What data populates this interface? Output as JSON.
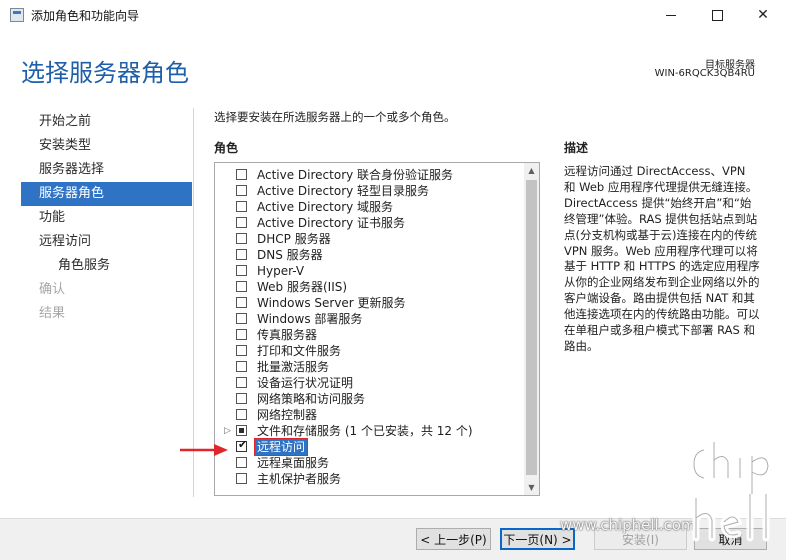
{
  "window": {
    "title": "添加角色和功能向导",
    "controls": {
      "minimize": "minimize-icon",
      "maximize": "maximize-icon",
      "close": "✕"
    }
  },
  "header": {
    "page_title": "选择服务器角色",
    "target_label": "目标服务器",
    "target_name": "WIN-6RQCK3QB4RU"
  },
  "nav": {
    "items": [
      {
        "label": "开始之前",
        "state": "normal"
      },
      {
        "label": "安装类型",
        "state": "normal"
      },
      {
        "label": "服务器选择",
        "state": "normal"
      },
      {
        "label": "服务器角色",
        "state": "active"
      },
      {
        "label": "功能",
        "state": "normal"
      },
      {
        "label": "远程访问",
        "state": "normal"
      },
      {
        "label": "角色服务",
        "state": "sub"
      },
      {
        "label": "确认",
        "state": "disabled"
      },
      {
        "label": "结果",
        "state": "disabled"
      }
    ]
  },
  "main": {
    "instruction": "选择要安装在所选服务器上的一个或多个角色。",
    "roles_header": "角色",
    "description_header": "描述",
    "description": "远程访问通过 DirectAccess、VPN 和 Web 应用程序代理提供无缝连接。DirectAccess 提供“始终开启”和“始终管理”体验。RAS 提供包括站点到站点(分支机构或基于云)连接在内的传统 VPN 服务。Web 应用程序代理可以将基于 HTTP 和 HTTPS 的选定应用程序从你的企业网络发布到企业网络以外的客户端设备。路由提供包括 NAT 和其他连接选项在内的传统路由功能。可以在单租户或多租户模式下部署 RAS 和路由。"
  },
  "roles": [
    {
      "label": "Active Directory 联合身份验证服务",
      "state": "unchecked"
    },
    {
      "label": "Active Directory 轻型目录服务",
      "state": "unchecked"
    },
    {
      "label": "Active Directory 域服务",
      "state": "unchecked"
    },
    {
      "label": "Active Directory 证书服务",
      "state": "unchecked"
    },
    {
      "label": "DHCP 服务器",
      "state": "unchecked"
    },
    {
      "label": "DNS 服务器",
      "state": "unchecked"
    },
    {
      "label": "Hyper-V",
      "state": "unchecked"
    },
    {
      "label": "Web 服务器(IIS)",
      "state": "unchecked"
    },
    {
      "label": "Windows Server 更新服务",
      "state": "unchecked"
    },
    {
      "label": "Windows 部署服务",
      "state": "unchecked"
    },
    {
      "label": "传真服务器",
      "state": "unchecked"
    },
    {
      "label": "打印和文件服务",
      "state": "unchecked"
    },
    {
      "label": "批量激活服务",
      "state": "unchecked"
    },
    {
      "label": "设备运行状况证明",
      "state": "unchecked"
    },
    {
      "label": "网络策略和访问服务",
      "state": "unchecked"
    },
    {
      "label": "网络控制器",
      "state": "unchecked"
    },
    {
      "label": "文件和存储服务 (1 个已安装，共 12 个)",
      "state": "partial",
      "expandable": true
    },
    {
      "label": "远程访问",
      "state": "checked",
      "selected": true
    },
    {
      "label": "远程桌面服务",
      "state": "unchecked"
    },
    {
      "label": "主机保护者服务",
      "state": "unchecked"
    }
  ],
  "buttons": {
    "prev": "< 上一步(P)",
    "next": "下一页(N) >",
    "install": "安装(I)",
    "cancel": "取消"
  },
  "watermark": {
    "url": "www.chiphell.com",
    "logo_text": "chip hell"
  },
  "colors": {
    "accent": "#2f73c4",
    "heading": "#1f5faa",
    "annotation": "#e0262b"
  }
}
